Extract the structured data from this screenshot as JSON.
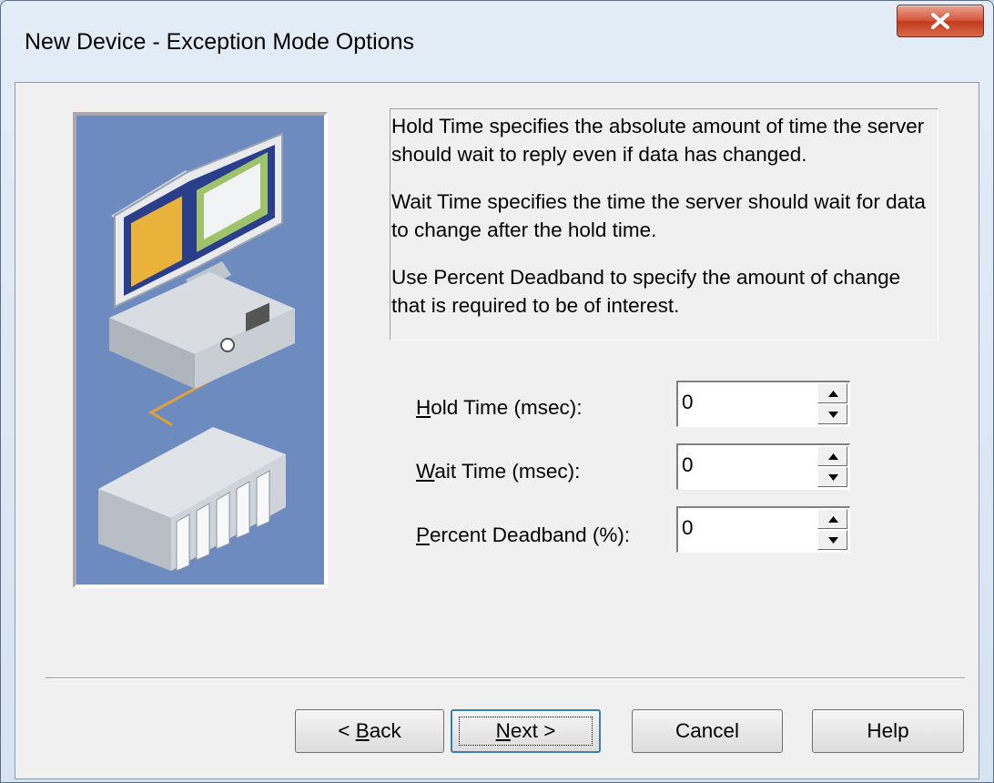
{
  "window": {
    "title": "New Device - Exception Mode Options"
  },
  "description": {
    "paragraphs": [
      "Hold Time specifies the absolute amount of time the server should wait to reply even if data has changed.",
      "Wait Time specifies the time the server should wait for data to change after the hold time.",
      "Use Percent Deadband to specify the amount of change that is required to be of interest."
    ]
  },
  "fields": {
    "hold_time": {
      "label_accel": "H",
      "label_rest": "old Time (msec):",
      "value": "0"
    },
    "wait_time": {
      "label_accel": "W",
      "label_rest": "ait Time (msec):",
      "value": "0"
    },
    "percent_deadband": {
      "label_accel": "P",
      "label_rest": "ercent Deadband (%):",
      "value": "0"
    }
  },
  "buttons": {
    "back": {
      "prefix": "< ",
      "accel": "B",
      "rest": "ack"
    },
    "next": {
      "accel": "N",
      "rest": "ext >"
    },
    "cancel": "Cancel",
    "help": "Help"
  },
  "colors": {
    "close_button": "#c8452a",
    "illustration_bg": "#6d8bbf",
    "dialog_bg": "#f0f0f0"
  },
  "icons": {
    "close": "close-x-icon",
    "spin_up": "spin-up-arrow-icon",
    "spin_down": "spin-down-arrow-icon"
  }
}
